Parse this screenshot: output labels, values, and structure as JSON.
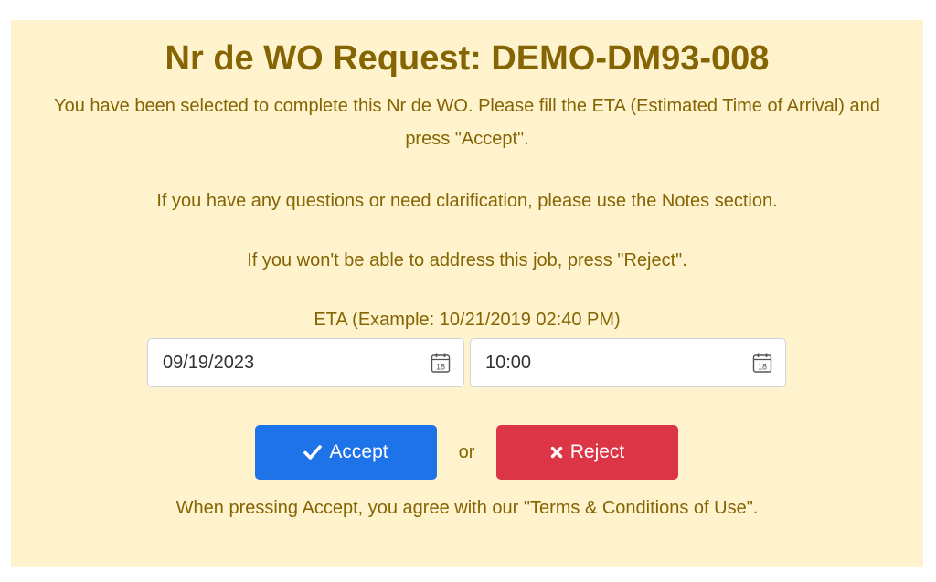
{
  "request": {
    "title": "Nr de WO Request: DEMO-DM93-008",
    "intro": "You have been selected to complete this Nr de WO. Please fill the ETA (Estimated Time of Arrival) and press \"Accept\".",
    "questions_note": "If you have any questions or need clarification, please use the Notes section.",
    "reject_note": "If you won't be able to address this job, press \"Reject\".",
    "eta_label": "ETA (Example: 10/21/2019 02:40 PM)",
    "date_value": "09/19/2023",
    "time_value": "10:00",
    "calendar_day": "18",
    "accept_label": "Accept",
    "or_text": "or",
    "reject_label": "Reject",
    "terms_text": "When pressing Accept, you agree with our \"Terms & Conditions of Use\"."
  },
  "colors": {
    "panel_bg": "#fff3cd",
    "text": "#856404",
    "accept_bg": "#1e73e8",
    "reject_bg": "#dc3545"
  },
  "icons": {
    "date_picker": "calendar-icon",
    "time_picker": "calendar-icon",
    "accept": "check-icon",
    "reject": "times-icon"
  }
}
